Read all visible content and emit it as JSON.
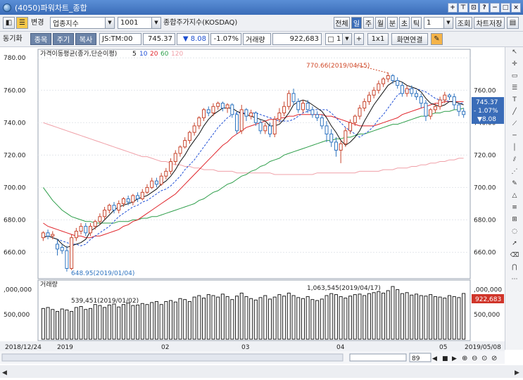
{
  "window": {
    "title": "(4050)파워차트_종합",
    "buttons": [
      "+",
      "⊤",
      "⊡",
      "?",
      "−",
      "□",
      "×"
    ]
  },
  "toolbar1": {
    "change_label": "변경",
    "market_select": "업종지수",
    "code_input": "1001",
    "index_name": "종합주가지수(KOSDAQ)",
    "period_buttons": [
      "전체",
      "일",
      "주",
      "월",
      "분",
      "초",
      "틱"
    ],
    "active_period": "일",
    "count_value": "1",
    "lookup_label": "조회",
    "save_label": "차트저장"
  },
  "toolbar2": {
    "sync_label": "동기화",
    "tab_stock": "종목",
    "tab_period": "주기",
    "tab_copy": "복사",
    "symbol": "JS:TM:00",
    "price": "745.37",
    "change": "▼ 8.08",
    "change_pct": "-1.07%",
    "volume_label": "거래량",
    "volume_value": "922,683",
    "count_value": "1",
    "ratio_label": "1x1",
    "connect_label": "화면연결"
  },
  "chart_data": [
    {
      "type": "candlestick",
      "legend": "가격이동평균(종가,단순이평)",
      "ma_periods": [
        "5",
        "10",
        "20",
        "60",
        "120"
      ],
      "ma_colors": {
        "5": "#111111",
        "10": "#1f4fd6",
        "20": "#e0242a",
        "60": "#2e9e4a",
        "120": "#f0a0a8"
      },
      "y_ticks": [
        "780.00",
        "760.00",
        "740.00",
        "720.00",
        "700.00",
        "680.00",
        "660.00"
      ],
      "y_right_ticks": [
        "760.00",
        "740.00",
        "720.00",
        "700.00",
        "680.00",
        "660.00"
      ],
      "ylim": [
        645,
        784
      ],
      "x_ticks": [
        "2018/12/24",
        "2019",
        "02",
        "03",
        "04",
        "05",
        "2019/05/08"
      ],
      "annotations": {
        "high": "770.66(2019/04/15)",
        "low": "648.95(2019/01/04)"
      },
      "last_price_box": {
        "price": "745.37",
        "pct": "- 1.07%",
        "chg": "▼8.08"
      },
      "right_axis_color": "#3a6cb8",
      "up_color": "#c8462e",
      "down_color": "#2f74c0",
      "candles": [
        [
          669,
          672,
          673,
          667
        ],
        [
          672,
          670,
          674,
          668
        ],
        [
          670,
          671,
          673,
          668
        ],
        [
          665,
          662,
          668,
          658
        ],
        [
          663,
          661,
          665,
          659
        ],
        [
          661,
          650,
          664,
          649
        ],
        [
          650,
          669,
          671,
          649
        ],
        [
          669,
          673,
          675,
          667
        ],
        [
          673,
          676,
          678,
          671
        ],
        [
          676,
          672,
          678,
          670
        ],
        [
          672,
          676,
          678,
          670
        ],
        [
          676,
          679,
          680,
          674
        ],
        [
          679,
          682,
          684,
          677
        ],
        [
          682,
          686,
          688,
          680
        ],
        [
          686,
          689,
          690,
          684
        ],
        [
          689,
          686,
          691,
          684
        ],
        [
          686,
          690,
          692,
          684
        ],
        [
          690,
          693,
          694,
          688
        ],
        [
          693,
          691,
          695,
          689
        ],
        [
          691,
          695,
          696,
          689
        ],
        [
          695,
          693,
          697,
          691
        ],
        [
          693,
          697,
          699,
          692
        ],
        [
          697,
          700,
          702,
          696
        ],
        [
          700,
          704,
          706,
          699
        ],
        [
          704,
          702,
          706,
          700
        ],
        [
          702,
          707,
          709,
          701
        ],
        [
          707,
          710,
          712,
          705
        ],
        [
          710,
          716,
          718,
          708
        ],
        [
          716,
          721,
          723,
          714
        ],
        [
          721,
          725,
          726,
          719
        ],
        [
          725,
          729,
          731,
          724
        ],
        [
          729,
          734,
          735,
          727
        ],
        [
          734,
          738,
          740,
          732
        ],
        [
          738,
          743,
          744,
          736
        ],
        [
          743,
          748,
          749,
          741
        ],
        [
          748,
          746,
          750,
          744
        ],
        [
          746,
          750,
          752,
          744
        ],
        [
          750,
          752,
          753,
          748
        ],
        [
          752,
          749,
          753,
          747
        ],
        [
          749,
          751,
          752,
          746
        ],
        [
          751,
          745,
          752,
          743
        ],
        [
          745,
          735,
          747,
          733
        ],
        [
          735,
          748,
          751,
          733
        ],
        [
          748,
          744,
          749,
          741
        ],
        [
          744,
          746,
          748,
          742
        ],
        [
          746,
          740,
          747,
          738
        ],
        [
          740,
          735,
          742,
          733
        ],
        [
          735,
          738,
          740,
          733
        ],
        [
          738,
          733,
          740,
          731
        ],
        [
          733,
          742,
          744,
          731
        ],
        [
          742,
          746,
          749,
          740
        ],
        [
          746,
          750,
          753,
          744
        ],
        [
          750,
          758,
          760,
          748
        ],
        [
          758,
          753,
          761,
          751
        ],
        [
          753,
          748,
          755,
          746
        ],
        [
          748,
          752,
          754,
          746
        ],
        [
          752,
          748,
          754,
          746
        ],
        [
          748,
          745,
          750,
          743
        ],
        [
          745,
          743,
          747,
          741
        ],
        [
          743,
          738,
          745,
          736
        ],
        [
          738,
          733,
          741,
          728
        ],
        [
          733,
          728,
          736,
          725
        ],
        [
          728,
          723,
          731,
          719
        ],
        [
          723,
          727,
          729,
          715
        ],
        [
          727,
          735,
          737,
          725
        ],
        [
          735,
          740,
          742,
          733
        ],
        [
          740,
          744,
          745,
          738
        ],
        [
          744,
          749,
          751,
          742
        ],
        [
          749,
          753,
          755,
          747
        ],
        [
          753,
          757,
          759,
          751
        ],
        [
          757,
          760,
          762,
          755
        ],
        [
          760,
          764,
          766,
          758
        ],
        [
          764,
          767,
          768,
          762
        ],
        [
          767,
          769,
          771,
          765
        ],
        [
          769,
          766,
          770,
          764
        ],
        [
          766,
          763,
          768,
          761
        ],
        [
          763,
          758,
          765,
          756
        ],
        [
          758,
          761,
          763,
          756
        ],
        [
          761,
          758,
          763,
          756
        ],
        [
          758,
          756,
          760,
          754
        ],
        [
          756,
          752,
          758,
          749
        ],
        [
          752,
          744,
          754,
          741
        ],
        [
          744,
          748,
          749,
          742
        ],
        [
          748,
          750,
          752,
          746
        ],
        [
          750,
          754,
          756,
          748
        ],
        [
          754,
          757,
          759,
          752
        ],
        [
          757,
          756,
          758,
          754
        ],
        [
          756,
          751,
          758,
          748
        ],
        [
          751,
          747,
          752,
          744
        ],
        [
          747,
          745,
          749,
          743
        ]
      ],
      "ma5": [
        669,
        670,
        669,
        668,
        665,
        663,
        664,
        665,
        666,
        668,
        673,
        675,
        677,
        680,
        683,
        686,
        688,
        689,
        690,
        691,
        693,
        694,
        695,
        697,
        699,
        702,
        704,
        707,
        711,
        716,
        720,
        725,
        729,
        733,
        738,
        742,
        745,
        747,
        749,
        749,
        749,
        747,
        746,
        745,
        744,
        743,
        742,
        741,
        738,
        738,
        739,
        742,
        746,
        751,
        753,
        754,
        753,
        751,
        749,
        747,
        743,
        738,
        734,
        729,
        726,
        728,
        731,
        735,
        741,
        746,
        751,
        755,
        759,
        763,
        765,
        766,
        765,
        763,
        762,
        761,
        759,
        755,
        752,
        751,
        750,
        751,
        753,
        753,
        752,
        751
      ],
      "ma10": [
        670,
        670,
        669,
        668,
        667,
        666,
        665,
        665,
        664,
        665,
        668,
        670,
        672,
        674,
        676,
        679,
        682,
        684,
        686,
        688,
        689,
        691,
        692,
        694,
        696,
        698,
        699,
        701,
        704,
        707,
        711,
        714,
        717,
        721,
        725,
        729,
        733,
        737,
        740,
        743,
        745,
        746,
        746,
        746,
        746,
        746,
        745,
        744,
        743,
        742,
        741,
        741,
        741,
        742,
        744,
        746,
        747,
        748,
        748,
        748,
        748,
        746,
        743,
        740,
        737,
        735,
        733,
        731,
        733,
        735,
        738,
        742,
        745,
        749,
        753,
        757,
        759,
        760,
        761,
        761,
        760,
        759,
        757,
        755,
        754,
        754,
        753,
        753,
        752,
        752
      ],
      "ma20": [
        678,
        676,
        675,
        674,
        673,
        672,
        671,
        670,
        670,
        669,
        669,
        670,
        670,
        671,
        672,
        673,
        674,
        676,
        677,
        679,
        680,
        682,
        684,
        686,
        688,
        690,
        692,
        694,
        696,
        699,
        702,
        705,
        708,
        711,
        714,
        717,
        720,
        723,
        726,
        728,
        731,
        733,
        735,
        737,
        738,
        739,
        740,
        741,
        742,
        742,
        743,
        743,
        744,
        744,
        745,
        745,
        745,
        745,
        745,
        745,
        744,
        744,
        743,
        742,
        741,
        740,
        739,
        738,
        738,
        738,
        738,
        739,
        740,
        741,
        742,
        743,
        745,
        746,
        747,
        748,
        749,
        750,
        751,
        752,
        752,
        753,
        753,
        753,
        753,
        753
      ],
      "ma60": [
        700,
        696,
        692,
        689,
        686,
        684,
        682,
        681,
        680,
        679,
        679,
        678,
        678,
        678,
        678,
        678,
        679,
        679,
        679,
        680,
        680,
        681,
        681,
        682,
        682,
        683,
        684,
        685,
        686,
        687,
        688,
        689,
        690,
        692,
        693,
        695,
        697,
        698,
        700,
        702,
        703,
        705,
        707,
        708,
        710,
        711,
        713,
        714,
        716,
        717,
        718,
        720,
        721,
        722,
        723,
        724,
        725,
        726,
        727,
        728,
        729,
        729,
        730,
        730,
        731,
        731,
        732,
        733,
        733,
        734,
        735,
        736,
        737,
        738,
        739,
        739,
        740,
        741,
        742,
        743,
        744,
        744,
        745,
        746,
        746,
        747,
        747,
        748,
        748,
        749
      ],
      "ma120": [
        740,
        739,
        738,
        737,
        736,
        735,
        734,
        733,
        732,
        731,
        730,
        729,
        728,
        727,
        726,
        725,
        724,
        723,
        722,
        721,
        720,
        719,
        719,
        718,
        717,
        716,
        716,
        715,
        714,
        714,
        713,
        713,
        712,
        712,
        711,
        711,
        711,
        710,
        710,
        710,
        710,
        709,
        709,
        709,
        709,
        709,
        709,
        709,
        709,
        708,
        708,
        708,
        708,
        708,
        708,
        708,
        708,
        708,
        709,
        709,
        709,
        709,
        709,
        709,
        709,
        709,
        709,
        710,
        710,
        710,
        710,
        710,
        711,
        711,
        711,
        712,
        712,
        712,
        713,
        713,
        714,
        714,
        715,
        715,
        716,
        716,
        717,
        717,
        718,
        718
      ]
    },
    {
      "type": "bar",
      "legend": "거래량",
      "y_ticks": [
        ",000,000",
        "500,000"
      ],
      "ylim": [
        0,
        1150000
      ],
      "annotations": {
        "high": "1,063,545(2019/04/17)",
        "low": "539,451(2019/01/02)"
      },
      "last_volume_box": "922,683",
      "values": [
        620000,
        640000,
        600000,
        560000,
        610000,
        590000,
        560000,
        640000,
        660000,
        600000,
        620000,
        700000,
        680000,
        640000,
        690000,
        710000,
        650000,
        700000,
        730000,
        680000,
        690000,
        720000,
        700000,
        740000,
        760000,
        700000,
        760000,
        780000,
        750000,
        820000,
        800000,
        760000,
        850000,
        880000,
        830000,
        900000,
        880000,
        850000,
        910000,
        860000,
        800000,
        870000,
        930000,
        860000,
        820000,
        790000,
        840000,
        880000,
        810000,
        850000,
        900000,
        870000,
        930000,
        880000,
        840000,
        820000,
        860000,
        800000,
        780000,
        810000,
        880000,
        920000,
        900000,
        860000,
        830000,
        870000,
        900000,
        910000,
        880000,
        920000,
        940000,
        960000,
        930000,
        980000,
        1063545,
        1000000,
        920000,
        940000,
        890000,
        910000,
        880000,
        870000,
        900000,
        860000,
        850000,
        830000,
        880000,
        860000,
        840000,
        922683
      ]
    }
  ],
  "bottom_nav": {
    "page_value": "89"
  }
}
